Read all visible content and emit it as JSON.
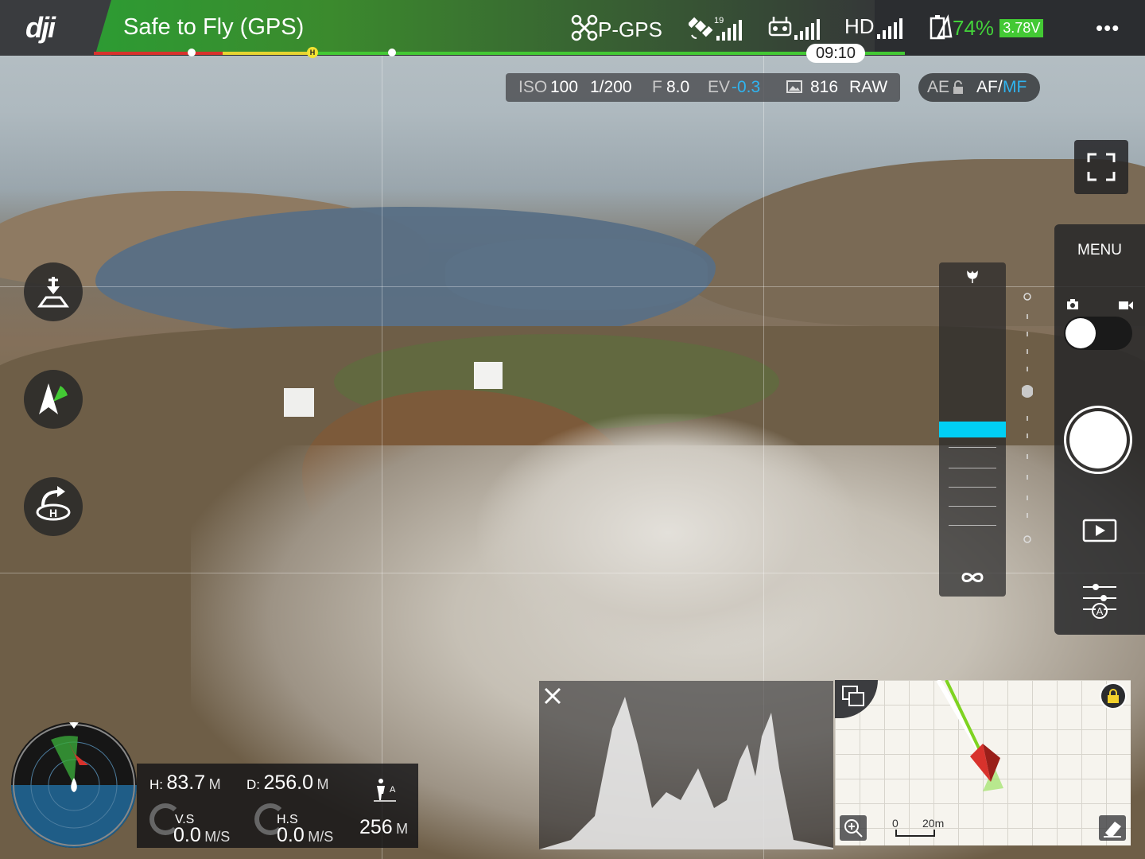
{
  "topbar": {
    "logo": "dji",
    "status": "Safe to Fly (GPS)",
    "flight_mode": "P-GPS",
    "satellite_count": "19",
    "video_link": "HD",
    "battery_percent": "74%",
    "battery_voltage": "3.78V",
    "flight_time": "09:10",
    "home_marker": "H",
    "icons": {
      "drone": "drone-icon",
      "satellite": "satellite-icon",
      "remote": "remote-controller-icon",
      "battery": "battery-icon",
      "more": "more-icon"
    }
  },
  "camera_settings": {
    "iso_label": "ISO",
    "iso_value": "100",
    "shutter": "1/200",
    "aperture_label": "F",
    "aperture_value": "8.0",
    "ev_label": "EV",
    "ev_value": "-0.3",
    "photos_remaining": "816",
    "format": "RAW",
    "ae_label": "AE",
    "af_label": "AF/",
    "mf_label": "MF"
  },
  "left_buttons": [
    {
      "name": "auto-land-icon"
    },
    {
      "name": "intelligent-flight-icon"
    },
    {
      "name": "return-home-icon"
    }
  ],
  "right_panel": {
    "menu_label": "MENU",
    "photo_icon": "camera-icon",
    "video_icon": "video-icon",
    "playback_icon": "play-icon",
    "settings_icon": "camera-settings-icon"
  },
  "focus_panel": {
    "top_icon": "macro-icon",
    "bottom_icon": "infinity-icon",
    "focus_level": 0.5
  },
  "telemetry": {
    "h_label": "H:",
    "h_value": "83.7",
    "h_unit": "M",
    "d_label": "D:",
    "d_value": "256.0",
    "d_unit": "M",
    "vs_label": "V.S",
    "vs_value": "0.0",
    "vs_unit": "M/S",
    "hs_label": "H.S",
    "hs_value": "0.0",
    "hs_unit": "M/S",
    "dist_value": "256",
    "dist_unit": "M"
  },
  "map": {
    "scale_start": "0",
    "scale_end": "20m"
  },
  "colors": {
    "safe_green": "#43c934",
    "accent_blue": "#2fb4f0",
    "focus_cyan": "#00cff5",
    "warning_red": "#d8322c",
    "warning_yellow": "#e7d431"
  }
}
